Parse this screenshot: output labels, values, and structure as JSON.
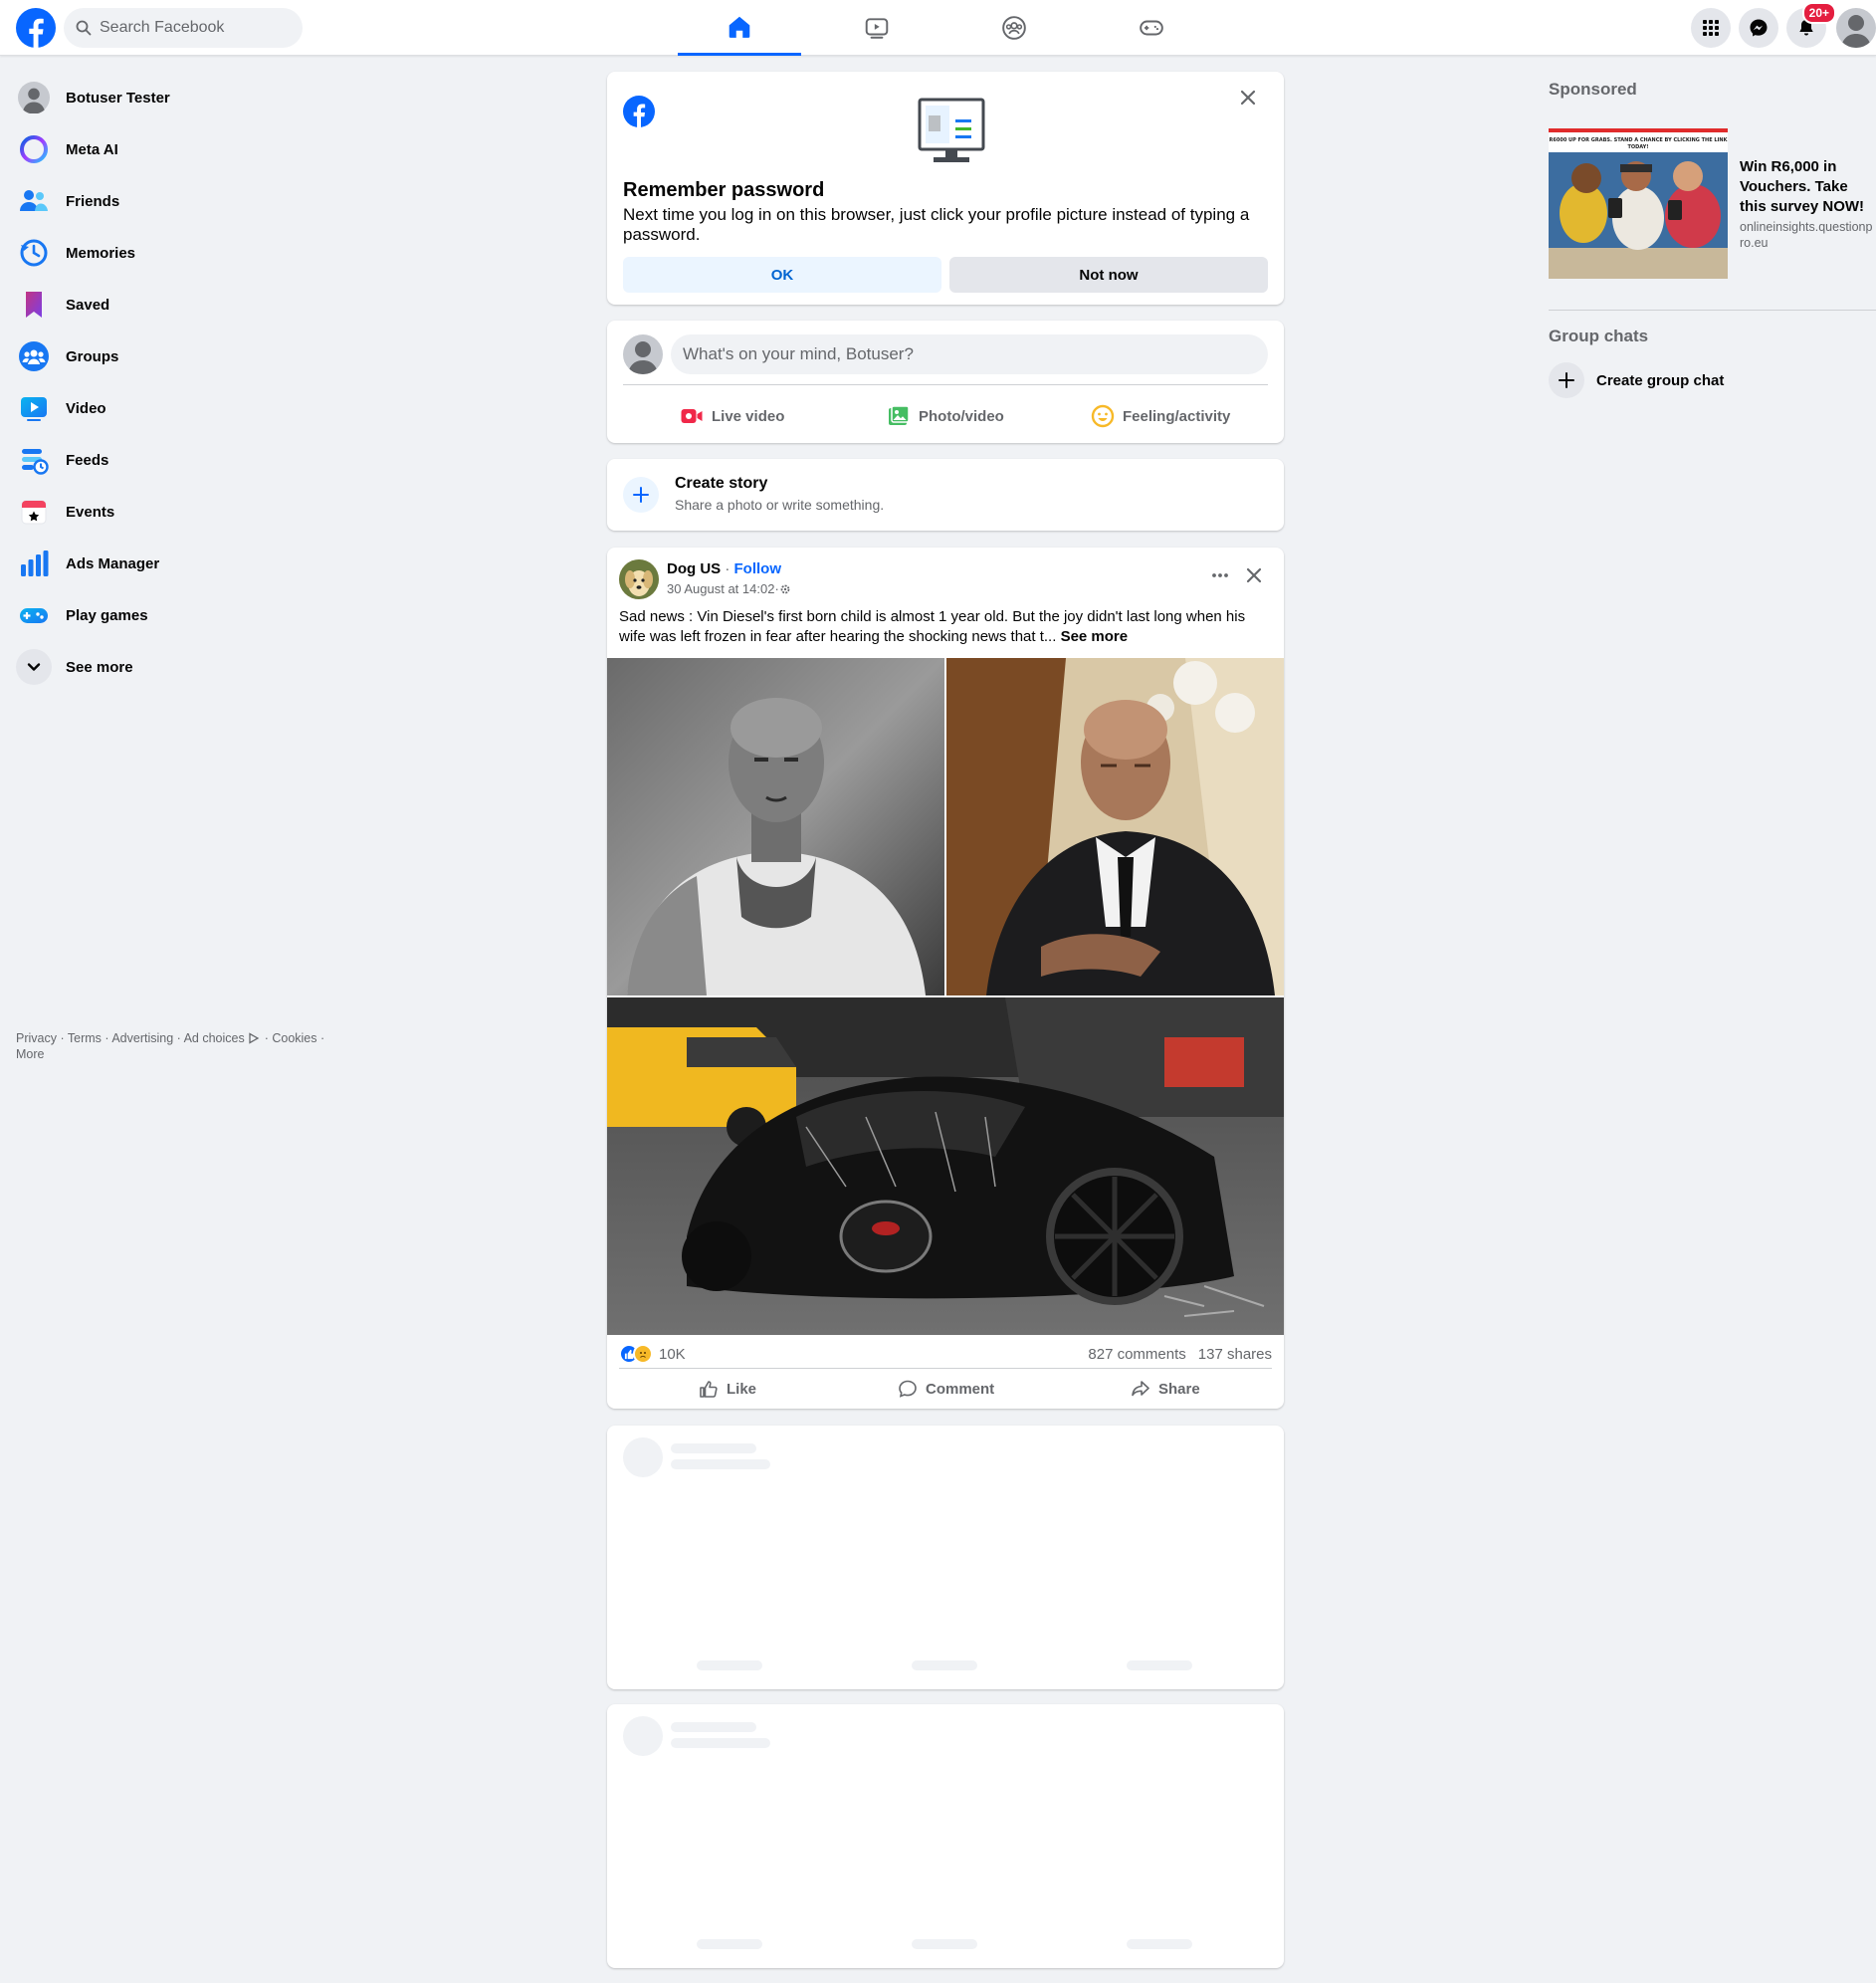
{
  "topbar": {
    "search_placeholder": "Search Facebook",
    "tabs": [
      "Home",
      "Video",
      "Groups",
      "Gaming"
    ],
    "notification_badge": "20+"
  },
  "sidebar": {
    "items": [
      {
        "label": "Botuser Tester",
        "icon": "avatar"
      },
      {
        "label": "Meta AI",
        "icon": "meta-ai-icon"
      },
      {
        "label": "Friends",
        "icon": "friends-icon"
      },
      {
        "label": "Memories",
        "icon": "memories-icon"
      },
      {
        "label": "Saved",
        "icon": "saved-icon"
      },
      {
        "label": "Groups",
        "icon": "groups-icon"
      },
      {
        "label": "Video",
        "icon": "video-icon"
      },
      {
        "label": "Feeds",
        "icon": "feeds-icon"
      },
      {
        "label": "Events",
        "icon": "events-icon"
      },
      {
        "label": "Ads Manager",
        "icon": "ads-manager-icon"
      },
      {
        "label": "Play games",
        "icon": "play-games-icon"
      },
      {
        "label": "See more",
        "icon": "chevron-down-icon"
      }
    ],
    "footer": {
      "privacy": "Privacy",
      "terms": "Terms",
      "advertising": "Advertising",
      "ad_choices": "Ad choices",
      "cookies": "Cookies",
      "more": "More",
      "sep": " · "
    }
  },
  "password_card": {
    "title": "Remember password",
    "body": "Next time you log in on this browser, just click your profile picture instead of typing a password.",
    "ok": "OK",
    "not_now": "Not now"
  },
  "composer": {
    "placeholder": "What's on your mind, Botuser?",
    "live_video": "Live video",
    "photo_video": "Photo/video",
    "feeling": "Feeling/activity"
  },
  "story": {
    "title": "Create story",
    "subtitle": "Share a photo or write something."
  },
  "post": {
    "author": "Dog US",
    "separator": " · ",
    "follow": "Follow",
    "time": "30 August at 14:02",
    "meta_sep": " · ",
    "text": "Sad news : Vin Diesel's first born child is almost 1 year old. But the joy didn't last long when his wife was left frozen in fear after hearing the shocking news that t... ",
    "see_more": "See more",
    "reaction_count": "10K",
    "comments": "827 comments",
    "shares": "137 shares",
    "like": "Like",
    "comment": "Comment",
    "share": "Share"
  },
  "right": {
    "sponsored": "Sponsored",
    "ad_title": "Win R6,000 in Vouchers. Take this survey NOW!",
    "ad_url": "onlineinsights.questionpro.eu",
    "ad_banner": "R6000 UP FOR GRABS. STAND A CHANCE BY CLICKING THE LINK TODAY!",
    "group_chats": "Group chats",
    "create_group_chat": "Create group chat"
  },
  "colors": {
    "brand": "#0866ff",
    "background": "#f0f2f5",
    "badge": "#e41e3f"
  }
}
